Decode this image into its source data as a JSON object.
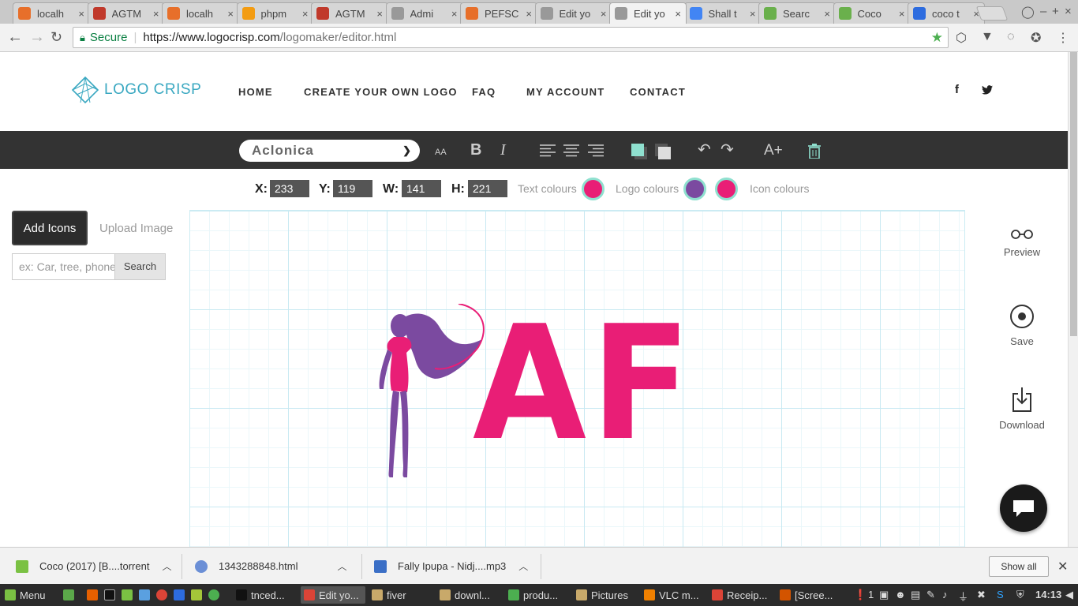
{
  "browser": {
    "tabs": [
      {
        "title": "localh",
        "icon": "xampp-icon",
        "color": "#e76f2a"
      },
      {
        "title": "AGTM",
        "icon": "agtm-icon",
        "color": "#c0392b"
      },
      {
        "title": "localh",
        "icon": "xampp-icon",
        "color": "#e76f2a"
      },
      {
        "title": "phpm",
        "icon": "phpmyadmin-icon",
        "color": "#f39c12"
      },
      {
        "title": "AGTM",
        "icon": "agtm-icon",
        "color": "#c0392b"
      },
      {
        "title": "Admi",
        "icon": "page-icon",
        "color": "#999999"
      },
      {
        "title": "PEFSC",
        "icon": "xampp-icon",
        "color": "#e76f2a"
      },
      {
        "title": "Edit yo",
        "icon": "page-icon",
        "color": "#999999"
      },
      {
        "title": "Edit yo",
        "icon": "page-icon",
        "color": "#999999",
        "active": true
      },
      {
        "title": "Shall t",
        "icon": "google-icon",
        "color": "#4285f4"
      },
      {
        "title": "Searc",
        "icon": "yts-icon",
        "color": "#6ab04c"
      },
      {
        "title": "Coco",
        "icon": "yts-icon",
        "color": "#6ab04c"
      },
      {
        "title": "coco t",
        "icon": "t2-icon",
        "color": "#2d6cdf"
      }
    ],
    "secure_label": "Secure",
    "url_scheme_host": "https://www.logocrisp.com",
    "url_path": "/logomaker/editor.html"
  },
  "site": {
    "logo_text": "LOGO CRISP",
    "logo_color": "#3aa8c1",
    "nav": [
      "HOME",
      "CREATE YOUR OWN LOGO",
      "FAQ",
      "MY ACCOUNT",
      "CONTACT"
    ],
    "social": [
      "facebook-icon",
      "twitter-icon"
    ]
  },
  "toolbar": {
    "font": "Aclonica",
    "size_glyph": "AA",
    "bold_glyph": "B",
    "italic_glyph": "I",
    "add_text_glyph": "A+"
  },
  "props": {
    "x_label": "X:",
    "x_value": "233",
    "y_label": "Y:",
    "y_value": "119",
    "w_label": "W:",
    "w_value": "141",
    "h_label": "H:",
    "h_value": "221",
    "text_colours_label": "Text colours",
    "logo_colours_label": "Logo colours",
    "icon_colours_label": "Icon colours",
    "text_colour": "#e91e76",
    "logo_colours": [
      "#7b4aa0",
      "#e91e76"
    ]
  },
  "left_panel": {
    "add_icons_label": "Add Icons",
    "upload_image_label": "Upload Image",
    "search_placeholder": "ex: Car, tree, phone",
    "search_button": "Search"
  },
  "canvas": {
    "logo_text": "AF",
    "text_color": "#e91e76",
    "figure_colors": [
      "#7b4aa0",
      "#e91e76"
    ]
  },
  "right_panel": {
    "preview_label": "Preview",
    "save_label": "Save",
    "download_label": "Download"
  },
  "downloads": {
    "items": [
      {
        "name": "Coco (2017) [B....torrent",
        "icon": "torrent-icon"
      },
      {
        "name": "1343288848.html",
        "icon": "html-file-icon"
      },
      {
        "name": "Fally Ipupa - Nidj....mp3",
        "icon": "audio-file-icon"
      }
    ],
    "show_all_label": "Show all"
  },
  "taskbar": {
    "menu_label": "Menu",
    "windows": [
      {
        "label": "tnced...",
        "icon": "terminal-icon"
      },
      {
        "label": "Edit yo...",
        "icon": "chrome-icon",
        "active": true
      },
      {
        "label": "fiver",
        "icon": "folder-icon"
      },
      {
        "label": "downl...",
        "icon": "folder-icon"
      },
      {
        "label": "produ...",
        "icon": "chrome-app-icon"
      },
      {
        "label": "Pictures",
        "icon": "folder-icon"
      },
      {
        "label": "VLC m...",
        "icon": "vlc-icon"
      },
      {
        "label": "Receip...",
        "icon": "chrome-icon"
      },
      {
        "label": "[Scree...",
        "icon": "screenshot-icon"
      }
    ],
    "tray_count": "1",
    "clock": "14:13"
  }
}
